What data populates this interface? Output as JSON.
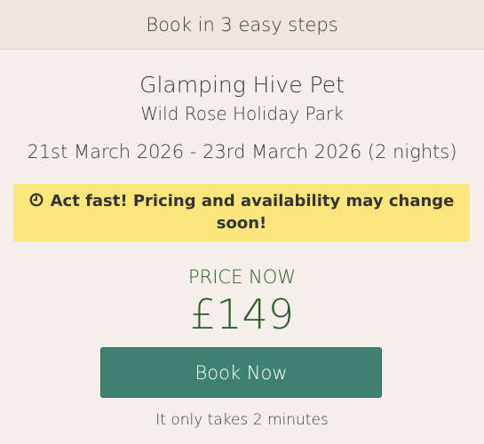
{
  "header": {
    "text": "Book in 3 easy steps"
  },
  "booking": {
    "title": "Glamping Hive Pet",
    "park": "Wild Rose Holiday Park",
    "dates": "21st March 2026 - 23rd March 2026 (2 nights)"
  },
  "alert": {
    "icon": "clock-icon",
    "text": "Act fast! Pricing and availability may change soon!",
    "background_color": "#fbe57c"
  },
  "price": {
    "label": "PRICE NOW",
    "amount": "£149",
    "color": "#2d5a27"
  },
  "cta": {
    "label": "Book Now",
    "subtext": "It only takes 2 minutes",
    "color": "#3e8170"
  }
}
